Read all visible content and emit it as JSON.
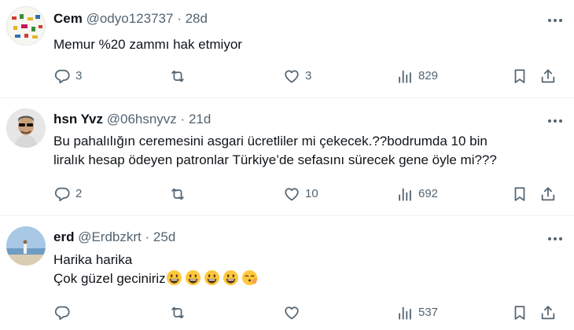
{
  "tweets": [
    {
      "name": "Cem",
      "handle": "@odyo123737",
      "sep": "·",
      "time": "28d",
      "lines": [
        "Memur %20 zammı hak etmiyor"
      ],
      "replies": "3",
      "retweets": "",
      "likes": "3",
      "views": "829"
    },
    {
      "name": "hsn Yvz",
      "handle": "@06hsnyvz",
      "sep": "·",
      "time": "21d",
      "lines": [
        "Bu pahalılığın ceremesini asgari ücretliler mi çekecek.??bodrumda 10 bin",
        "liralık hesap ödeyen patronlar Türkiye’de sefasını sürecek gene öyle mi???"
      ],
      "replies": "2",
      "retweets": "",
      "likes": "10",
      "views": "692"
    },
    {
      "name": "erd",
      "handle": "@Erdbzkrt",
      "sep": "·",
      "time": "25d",
      "lines": [
        "Harika harika",
        "Çok güzel geciniriz"
      ],
      "emojis": [
        "grinning-face",
        "grinning-face",
        "grinning-face",
        "grinning-face",
        "face-exhaling"
      ],
      "replies": "",
      "retweets": "",
      "likes": "",
      "views": "537"
    }
  ],
  "icons": {
    "reply": "reply-icon",
    "retweet": "retweet-icon",
    "like": "heart-icon",
    "views": "views-icon",
    "bookmark": "bookmark-icon",
    "share": "share-icon",
    "more": "more-icon"
  },
  "colors": {
    "text": "#0f1419",
    "secondary": "#536471",
    "divider": "#eff3f4"
  }
}
